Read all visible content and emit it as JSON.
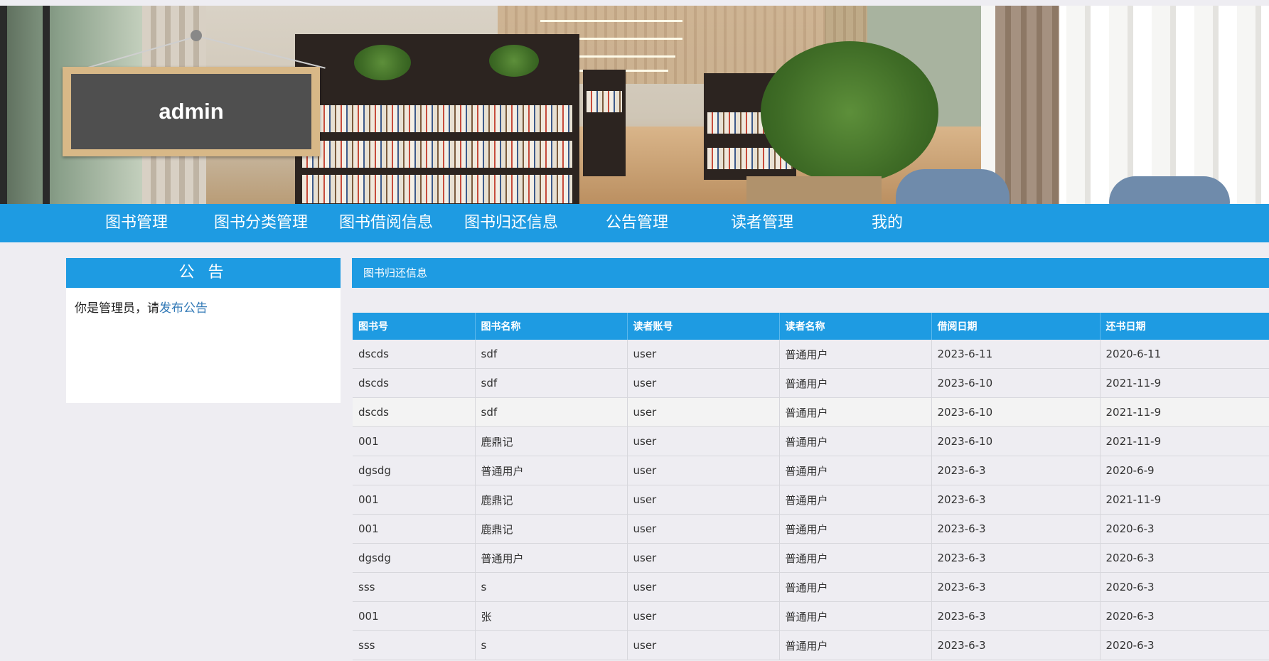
{
  "banner": {
    "username": "admin"
  },
  "nav": {
    "items": [
      {
        "label": "图书管理"
      },
      {
        "label": "图书分类管理"
      },
      {
        "label": "图书借阅信息"
      },
      {
        "label": "图书归还信息"
      },
      {
        "label": "公告管理"
      },
      {
        "label": "读者管理"
      },
      {
        "label": "我的"
      }
    ]
  },
  "notice": {
    "title": "公 告",
    "text": "你是管理员，请",
    "link": "发布公告"
  },
  "panel": {
    "title": "图书归还信息"
  },
  "table": {
    "headers": [
      "图书号",
      "图书名称",
      "读者账号",
      "读者名称",
      "借阅日期",
      "还书日期"
    ],
    "rows": [
      [
        "dscds",
        "sdf",
        "user",
        "普通用户",
        "2023-6-11",
        "2020-6-11"
      ],
      [
        "dscds",
        "sdf",
        "user",
        "普通用户",
        "2023-6-10",
        "2021-11-9"
      ],
      [
        "dscds",
        "sdf",
        "user",
        "普通用户",
        "2023-6-10",
        "2021-11-9"
      ],
      [
        "001",
        "鹿鼎记",
        "user",
        "普通用户",
        "2023-6-10",
        "2021-11-9"
      ],
      [
        "dgsdg",
        "普通用户",
        "user",
        "普通用户",
        "2023-6-3",
        "2020-6-9"
      ],
      [
        "001",
        "鹿鼎记",
        "user",
        "普通用户",
        "2023-6-3",
        "2021-11-9"
      ],
      [
        "001",
        "鹿鼎记",
        "user",
        "普通用户",
        "2023-6-3",
        "2020-6-3"
      ],
      [
        "dgsdg",
        "普通用户",
        "user",
        "普通用户",
        "2023-6-3",
        "2020-6-3"
      ],
      [
        "sss",
        "s",
        "user",
        "普通用户",
        "2023-6-3",
        "2020-6-3"
      ],
      [
        "001",
        "张",
        "user",
        "普通用户",
        "2023-6-3",
        "2020-6-3"
      ],
      [
        "sss",
        "s",
        "user",
        "普通用户",
        "2023-6-3",
        "2020-6-3"
      ]
    ]
  },
  "colors": {
    "primary": "#1e9be2",
    "background": "#eeedf2",
    "link": "#337ab7"
  }
}
